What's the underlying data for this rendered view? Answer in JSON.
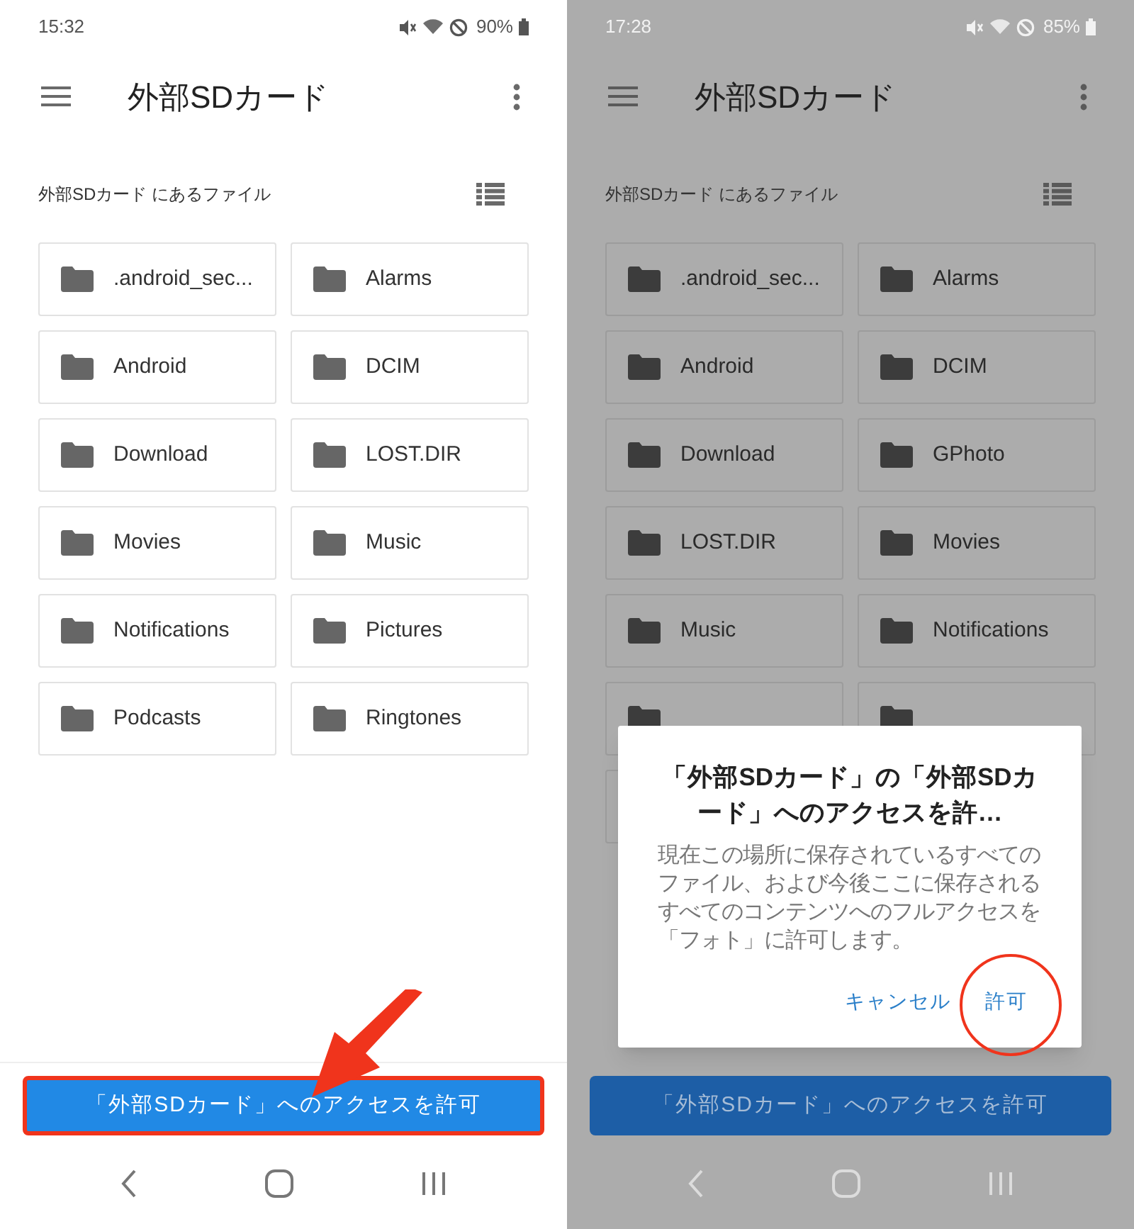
{
  "screens": [
    {
      "dimmed": false,
      "status_bar": {
        "time": "15:32",
        "battery": "90%"
      },
      "title": "外部SDカード",
      "subtitle": "外部SDカード にあるファイル",
      "folders": [
        {
          "label": ".android_sec..."
        },
        {
          "label": "Alarms"
        },
        {
          "label": "Android"
        },
        {
          "label": "DCIM"
        },
        {
          "label": "Download"
        },
        {
          "label": "LOST.DIR"
        },
        {
          "label": "Movies"
        },
        {
          "label": "Music"
        },
        {
          "label": "Notifications"
        },
        {
          "label": "Pictures"
        },
        {
          "label": "Podcasts"
        },
        {
          "label": "Ringtones"
        }
      ],
      "access_button": {
        "label": "「外部SDカード」へのアクセスを許可",
        "highlighted": true
      },
      "annotation": {
        "kind": "arrow"
      }
    },
    {
      "dimmed": true,
      "status_bar": {
        "time": "17:28",
        "battery": "85%"
      },
      "title": "外部SDカード",
      "subtitle": "外部SDカード にあるファイル",
      "folders": [
        {
          "label": ".android_sec..."
        },
        {
          "label": "Alarms"
        },
        {
          "label": "Android"
        },
        {
          "label": "DCIM"
        },
        {
          "label": "Download"
        },
        {
          "label": "GPhoto"
        },
        {
          "label": "LOST.DIR"
        },
        {
          "label": "Movies"
        },
        {
          "label": "Music"
        },
        {
          "label": "Notifications"
        },
        {
          "kind": "covered"
        },
        {
          "kind": "covered"
        },
        {
          "kind": "edge"
        }
      ],
      "access_button": {
        "label": "「外部SDカード」へのアクセスを許可",
        "highlighted": false
      },
      "dialog": {
        "title": "「外部SDカード」の「外部SDカード」へのアクセスを許…",
        "message": "現在この場所に保存されているすべてのファイル、および今後ここに保存されるすべてのコンテンツへのフルアクセスを「フォト」に許可します。",
        "buttons": [
          {
            "label": "キャンセル",
            "circled": false
          },
          {
            "label": "許可",
            "circled": true
          }
        ]
      }
    }
  ]
}
